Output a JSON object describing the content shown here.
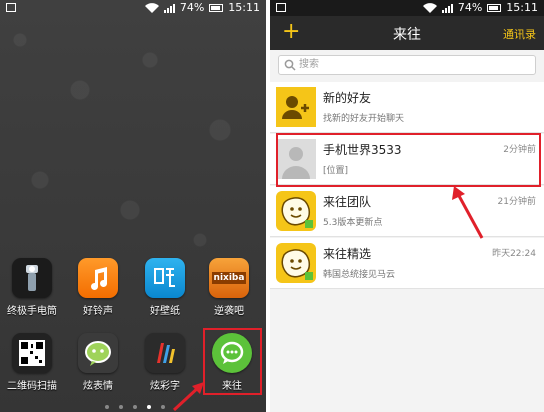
{
  "left_phone": {
    "status": {
      "battery": "74%",
      "time": "15:11"
    },
    "apps_row1": [
      {
        "label": "终极手电筒",
        "icon": "flashlight-icon"
      },
      {
        "label": "好铃声",
        "icon": "music-note-icon"
      },
      {
        "label": "好壁纸",
        "icon": "wallpaper-icon"
      },
      {
        "label": "逆袭吧",
        "icon": "nixiba-icon",
        "icon_text": "nixiba"
      }
    ],
    "apps_row2": [
      {
        "label": "二维码扫描",
        "icon": "qr-code-icon"
      },
      {
        "label": "炫表情",
        "icon": "emoticon-icon"
      },
      {
        "label": "炫彩字",
        "icon": "color-font-icon"
      },
      {
        "label": "来往",
        "icon": "laiwang-icon"
      }
    ]
  },
  "right_phone": {
    "status": {
      "battery": "74%",
      "time": "15:11"
    },
    "topbar": {
      "title": "来往",
      "contacts": "通讯录",
      "plus": "+"
    },
    "search": {
      "placeholder": "搜索"
    },
    "rows": [
      {
        "name": "新的好友",
        "sub": "找新的好友开始聊天",
        "time": "",
        "avatar": "add-friend-icon"
      },
      {
        "name": "手机世界3533",
        "sub": "[位置]",
        "time": "2分钟前",
        "avatar": "default-avatar-icon"
      },
      {
        "name": "来往团队",
        "sub": "5.3版本更新点",
        "time": "21分钟前",
        "avatar": "laiwang-mascot-icon"
      },
      {
        "name": "来往精选",
        "sub": "韩国总统接见马云",
        "time": "昨天22:24",
        "avatar": "laiwang-mascot-icon"
      }
    ]
  },
  "colors": {
    "accent": "#f5c518",
    "highlight": "#e0202a",
    "laiwang_green": "#5cc23a"
  }
}
